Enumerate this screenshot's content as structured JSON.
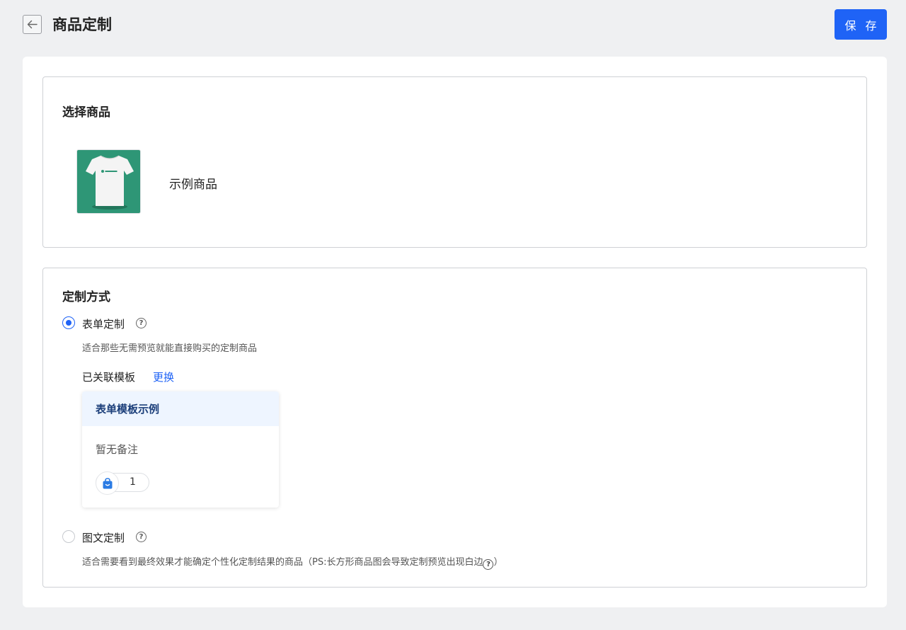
{
  "header": {
    "title": "商品定制",
    "save_label": "保 存"
  },
  "product_section": {
    "title": "选择商品",
    "product_name": "示例商品",
    "thumb_bg_color": "#2e9676"
  },
  "method_section": {
    "title": "定制方式",
    "form_option": {
      "label": "表单定制",
      "selected": true,
      "description": "适合那些无需预览就能直接购买的定制商品",
      "linked_label": "已关联模板",
      "change_label": "更换",
      "template": {
        "name": "表单模板示例",
        "note": "暂无备注",
        "count": "1"
      }
    },
    "image_option": {
      "label": "图文定制",
      "selected": false,
      "description": "适合需要看到最终效果才能确定个性化定制结果的商品（PS:长方形商品图会导致定制预览出现白边",
      "description_end": "）"
    }
  },
  "icons": {
    "back": "arrow-left-icon",
    "help": "question-circle-icon",
    "bag": "shopping-bag-icon"
  },
  "colors": {
    "primary": "#1f63f6",
    "background": "#eff0f2",
    "template_header_bg": "#eef5ff"
  }
}
